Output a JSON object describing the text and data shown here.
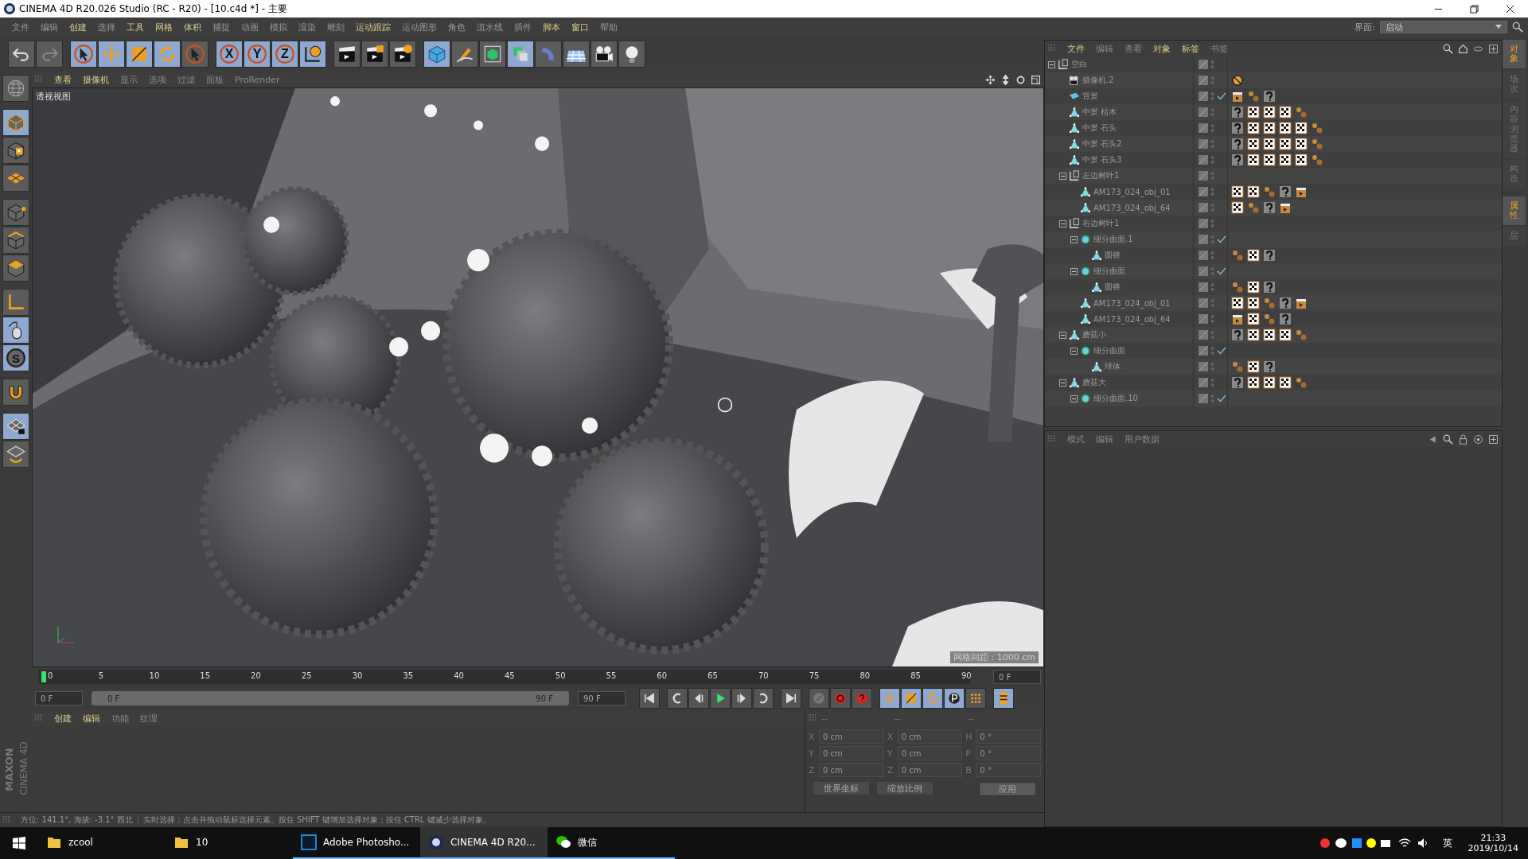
{
  "window": {
    "title": "CINEMA 4D R20.026 Studio (RC - R20) - [10.c4d *] - 主要"
  },
  "menu": [
    {
      "label": "文件",
      "highlighted": false
    },
    {
      "label": "编辑",
      "highlighted": false
    },
    {
      "label": "创建",
      "highlighted": true
    },
    {
      "label": "选择",
      "highlighted": false
    },
    {
      "label": "工具",
      "highlighted": true
    },
    {
      "label": "网格",
      "highlighted": true
    },
    {
      "label": "体积",
      "highlighted": true
    },
    {
      "label": "捕捉",
      "highlighted": false
    },
    {
      "label": "动画",
      "highlighted": false
    },
    {
      "label": "模拟",
      "highlighted": false
    },
    {
      "label": "渲染",
      "highlighted": false
    },
    {
      "label": "雕刻",
      "highlighted": false
    },
    {
      "label": "运动跟踪",
      "highlighted": true
    },
    {
      "label": "运动图形",
      "highlighted": false
    },
    {
      "label": "角色",
      "highlighted": false
    },
    {
      "label": "流水线",
      "highlighted": false
    },
    {
      "label": "插件",
      "highlighted": false
    },
    {
      "label": "脚本",
      "highlighted": true
    },
    {
      "label": "窗口",
      "highlighted": true
    },
    {
      "label": "帮助",
      "highlighted": false
    }
  ],
  "layout_selector": {
    "label": "界面:",
    "value": "启动"
  },
  "toolbar": [
    {
      "kind": "undo",
      "selected": false,
      "disabled": false
    },
    {
      "kind": "redo",
      "selected": false,
      "disabled": true
    },
    {
      "kind": "select",
      "selected": true,
      "disabled": false
    },
    {
      "kind": "move",
      "selected": true,
      "disabled": false
    },
    {
      "kind": "scale",
      "selected": true,
      "disabled": false
    },
    {
      "kind": "rotate",
      "selected": true,
      "disabled": false
    },
    {
      "kind": "select",
      "selected": false,
      "disabled": false
    },
    {
      "kind": "axis",
      "label": "X",
      "selected": true,
      "disabled": false
    },
    {
      "kind": "axis",
      "label": "Y",
      "selected": true,
      "disabled": false
    },
    {
      "kind": "axis",
      "label": "Z",
      "selected": true,
      "disabled": false
    },
    {
      "kind": "world",
      "selected": true,
      "disabled": false
    },
    {
      "kind": "render-view",
      "selected": false,
      "disabled": false
    },
    {
      "kind": "render-picture",
      "selected": false,
      "disabled": false
    },
    {
      "kind": "render-settings",
      "selected": false,
      "disabled": false
    },
    {
      "kind": "cube",
      "selected": true,
      "disabled": false
    },
    {
      "kind": "pen",
      "selected": false,
      "disabled": false
    },
    {
      "kind": "subdivision",
      "selected": false,
      "disabled": false
    },
    {
      "kind": "cloner",
      "selected": true,
      "disabled": false
    },
    {
      "kind": "deformer",
      "selected": false,
      "disabled": false
    },
    {
      "kind": "floor",
      "selected": false,
      "disabled": false
    },
    {
      "kind": "camera",
      "selected": false,
      "disabled": false
    },
    {
      "kind": "light",
      "selected": false,
      "disabled": false
    }
  ],
  "left_tools": [
    {
      "kind": "model",
      "selected": false
    },
    {
      "kind": "object",
      "selected": true
    },
    {
      "kind": "texture",
      "selected": false
    },
    {
      "kind": "workplane",
      "selected": false
    },
    {
      "kind": "points",
      "selected": false
    },
    {
      "kind": "edges",
      "selected": false
    },
    {
      "kind": "polygons",
      "selected": false
    },
    {
      "kind": "axis-mode",
      "selected": false
    },
    {
      "kind": "tweak",
      "selected": true
    },
    {
      "kind": "snap",
      "label": "S",
      "selected": true
    },
    {
      "kind": "magnet",
      "selected": false
    },
    {
      "kind": "lock-grid",
      "selected": true
    },
    {
      "kind": "grid-rotate",
      "selected": false
    }
  ],
  "viewport": {
    "tabs": [
      {
        "label": "查看",
        "highlighted": true
      },
      {
        "label": "摄像机",
        "highlighted": true
      },
      {
        "label": "显示",
        "highlighted": false
      },
      {
        "label": "选项",
        "highlighted": false
      },
      {
        "label": "过滤",
        "highlighted": false
      },
      {
        "label": "面板",
        "highlighted": false
      },
      {
        "label": "ProRender",
        "highlighted": false
      }
    ],
    "view_name": "透视视图",
    "grid_spacing": "网格间距 : 1000 cm"
  },
  "timeline": {
    "ticks": [
      "0",
      "5",
      "10",
      "15",
      "20",
      "25",
      "30",
      "35",
      "40",
      "45",
      "50",
      "55",
      "60",
      "65",
      "70",
      "75",
      "80",
      "85",
      "90"
    ],
    "level": 0,
    "current_frame": "0 F"
  },
  "transport": {
    "start_field": "0 F",
    "range": {
      "start": "0 F",
      "end": "90 F",
      "level": 1
    },
    "end_field": "90 F",
    "buttons": [
      {
        "kind": "first",
        "selected": false
      },
      {
        "kind": "prev-key",
        "selected": false
      },
      {
        "kind": "prev-frame",
        "selected": false
      },
      {
        "kind": "play",
        "selected": false
      },
      {
        "kind": "next-frame",
        "selected": false
      },
      {
        "kind": "next-key",
        "selected": false
      },
      {
        "kind": "last",
        "selected": false
      },
      {
        "kind": "keyframe",
        "selected": false
      },
      {
        "kind": "record",
        "selected": false
      },
      {
        "kind": "auto-key",
        "selected": false
      },
      {
        "kind": "key-move",
        "selected": true
      },
      {
        "kind": "key-scale",
        "selected": true
      },
      {
        "kind": "key-rotate",
        "selected": true
      },
      {
        "kind": "key-param",
        "selected": true
      },
      {
        "kind": "key-points",
        "selected": false
      },
      {
        "kind": "timeline-film",
        "selected": true
      }
    ]
  },
  "materials": {
    "tabs": [
      {
        "label": "创建",
        "highlighted": true
      },
      {
        "label": "编辑",
        "highlighted": true
      },
      {
        "label": "功能",
        "highlighted": false
      },
      {
        "label": "纹理",
        "highlighted": false
      }
    ]
  },
  "coordinates": {
    "columns": [
      {
        "header": "--",
        "fields": [
          {
            "axis": "X",
            "value": "0 cm"
          },
          {
            "axis": "Y",
            "value": "0 cm"
          },
          {
            "axis": "Z",
            "value": "0 cm"
          }
        ]
      },
      {
        "header": "--",
        "fields": [
          {
            "axis": "X",
            "value": "0 cm"
          },
          {
            "axis": "Y",
            "value": "0 cm"
          },
          {
            "axis": "Z",
            "value": "0 cm"
          }
        ]
      },
      {
        "header": "--",
        "fields": [
          {
            "axis": "H",
            "value": "0 °"
          },
          {
            "axis": "P",
            "value": "0 °"
          },
          {
            "axis": "B",
            "value": "0 °"
          }
        ]
      }
    ],
    "dropdowns": [
      "世界坐标",
      "缩放比例"
    ],
    "apply": "应用"
  },
  "logo": {
    "brand": "MAXON",
    "product": "CINEMA 4D"
  },
  "status_bar": {
    "orientation": "方位: 141.1°, 海拔: -3.1° 西北",
    "hint": "实时选择：点击并拖动鼠标选择元素。按住 SHIFT 键增加选择对象；按住 CTRL 键减少选择对象。"
  },
  "objects": {
    "tabs": [
      {
        "label": "文件",
        "highlighted": true
      },
      {
        "label": "编辑",
        "highlighted": false
      },
      {
        "label": "查看",
        "highlighted": false
      },
      {
        "label": "对象",
        "highlighted": true
      },
      {
        "label": "标签",
        "highlighted": true
      },
      {
        "label": "书签",
        "highlighted": false
      }
    ],
    "items": [
      {
        "name": "空白",
        "kind": "null",
        "expanded": true,
        "enabled": false,
        "children": [
          {
            "name": "摄像机.2",
            "kind": "camera",
            "enabled": false,
            "tags": [
              {
                "kind": "restrict"
              }
            ]
          },
          {
            "name": "背景",
            "kind": "background",
            "enabled": true,
            "tags": [
              {
                "kind": "clapper"
              },
              {
                "kind": "phong"
              },
              {
                "kind": "question"
              }
            ]
          },
          {
            "name": "中景 枯木",
            "kind": "polygon",
            "enabled": false,
            "tags": [
              {
                "kind": "question"
              },
              {
                "kind": "checker"
              },
              {
                "kind": "checker"
              },
              {
                "kind": "checker"
              },
              {
                "kind": "phong"
              }
            ]
          },
          {
            "name": "中景 石头",
            "kind": "polygon",
            "enabled": false,
            "tags": [
              {
                "kind": "question"
              },
              {
                "kind": "checker"
              },
              {
                "kind": "checker"
              },
              {
                "kind": "checker"
              },
              {
                "kind": "checker"
              },
              {
                "kind": "phong"
              }
            ]
          },
          {
            "name": "中景 石头2",
            "kind": "polygon",
            "enabled": false,
            "tags": [
              {
                "kind": "question"
              },
              {
                "kind": "checker"
              },
              {
                "kind": "checker"
              },
              {
                "kind": "checker"
              },
              {
                "kind": "checker"
              },
              {
                "kind": "phong"
              }
            ]
          },
          {
            "name": "中景 石头3",
            "kind": "polygon",
            "enabled": false,
            "tags": [
              {
                "kind": "question"
              },
              {
                "kind": "checker"
              },
              {
                "kind": "checker"
              },
              {
                "kind": "checker"
              },
              {
                "kind": "checker"
              },
              {
                "kind": "phong"
              }
            ]
          },
          {
            "name": "左边树叶1",
            "kind": "null",
            "expanded": true,
            "enabled": false,
            "children": [
              {
                "name": "AM173_024_obj_01",
                "kind": "polygon",
                "enabled": false,
                "tags": [
                  {
                    "kind": "checker"
                  },
                  {
                    "kind": "checker"
                  },
                  {
                    "kind": "phong"
                  },
                  {
                    "kind": "question"
                  },
                  {
                    "kind": "clapper"
                  }
                ]
              },
              {
                "name": "AM173_024_obj_64",
                "kind": "polygon",
                "enabled": false,
                "tags": [
                  {
                    "kind": "checker"
                  },
                  {
                    "kind": "phong"
                  },
                  {
                    "kind": "question"
                  },
                  {
                    "kind": "clapper"
                  }
                ]
              }
            ]
          },
          {
            "name": "右边树叶1",
            "kind": "null",
            "expanded": true,
            "enabled": false,
            "children": [
              {
                "name": "细分曲面.1",
                "kind": "subdivision",
                "expanded": true,
                "enabled": true,
                "children": [
                  {
                    "name": "圆锥",
                    "kind": "polygon",
                    "enabled": false,
                    "tags": [
                      {
                        "kind": "phong"
                      },
                      {
                        "kind": "checker"
                      },
                      {
                        "kind": "question"
                      }
                    ]
                  }
                ]
              },
              {
                "name": "细分曲面",
                "kind": "subdivision",
                "expanded": true,
                "enabled": true,
                "children": [
                  {
                    "name": "圆锥",
                    "kind": "polygon",
                    "enabled": false,
                    "tags": [
                      {
                        "kind": "phong"
                      },
                      {
                        "kind": "checker"
                      },
                      {
                        "kind": "question"
                      }
                    ]
                  }
                ]
              },
              {
                "name": "AM173_024_obj_01",
                "kind": "polygon",
                "enabled": false,
                "tags": [
                  {
                    "kind": "checker"
                  },
                  {
                    "kind": "checker"
                  },
                  {
                    "kind": "phong"
                  },
                  {
                    "kind": "question"
                  },
                  {
                    "kind": "clapper"
                  }
                ]
              },
              {
                "name": "AM173_024_obj_64",
                "kind": "polygon",
                "enabled": false,
                "tags": [
                  {
                    "kind": "clapper"
                  },
                  {
                    "kind": "checker"
                  },
                  {
                    "kind": "phong"
                  },
                  {
                    "kind": "question"
                  }
                ]
              }
            ]
          },
          {
            "name": "蘑菇小",
            "kind": "polygon",
            "expanded": true,
            "enabled": false,
            "tags": [
              {
                "kind": "question"
              },
              {
                "kind": "checker"
              },
              {
                "kind": "checker"
              },
              {
                "kind": "checker"
              },
              {
                "kind": "phong"
              }
            ],
            "children": [
              {
                "name": "细分曲面",
                "kind": "subdivision",
                "expanded": true,
                "enabled": true,
                "children": [
                  {
                    "name": "球体",
                    "kind": "polygon",
                    "enabled": false,
                    "tags": [
                      {
                        "kind": "phong"
                      },
                      {
                        "kind": "checker"
                      },
                      {
                        "kind": "question"
                      }
                    ]
                  }
                ]
              }
            ]
          },
          {
            "name": "蘑菇大",
            "kind": "polygon",
            "expanded": true,
            "enabled": false,
            "tags": [
              {
                "kind": "question"
              },
              {
                "kind": "checker"
              },
              {
                "kind": "checker"
              },
              {
                "kind": "checker"
              },
              {
                "kind": "phong"
              }
            ],
            "children": [
              {
                "name": "细分曲面.10",
                "kind": "subdivision",
                "expanded": true,
                "enabled": true
              }
            ]
          }
        ]
      }
    ]
  },
  "attributes": {
    "tabs": [
      {
        "label": "模式",
        "highlighted": false
      },
      {
        "label": "编辑",
        "highlighted": false
      },
      {
        "label": "用户数据",
        "highlighted": false
      }
    ]
  },
  "side_tabs_top": [
    {
      "label": "对象",
      "selected": true
    },
    {
      "label": "场次",
      "selected": false
    },
    {
      "label": "内容浏览器",
      "selected": false
    },
    {
      "label": "构造",
      "selected": false
    }
  ],
  "side_tabs_bottom": [
    {
      "label": "属性",
      "selected": true
    },
    {
      "label": "层",
      "selected": false
    }
  ],
  "taskbar": {
    "apps": [
      {
        "label": "zcool",
        "kind": "folder",
        "running": false,
        "selected": false
      },
      {
        "label": "10",
        "kind": "folder",
        "running": false,
        "selected": false
      },
      {
        "label": "Adobe Photosho...",
        "kind": "photoshop",
        "running": true,
        "selected": false
      },
      {
        "label": "CINEMA 4D R20...",
        "kind": "cinema",
        "running": true,
        "selected": true
      },
      {
        "label": "微信",
        "kind": "chat",
        "running": true,
        "selected": false
      }
    ],
    "language": "英",
    "time": "21:33",
    "date": "2019/10/14"
  }
}
